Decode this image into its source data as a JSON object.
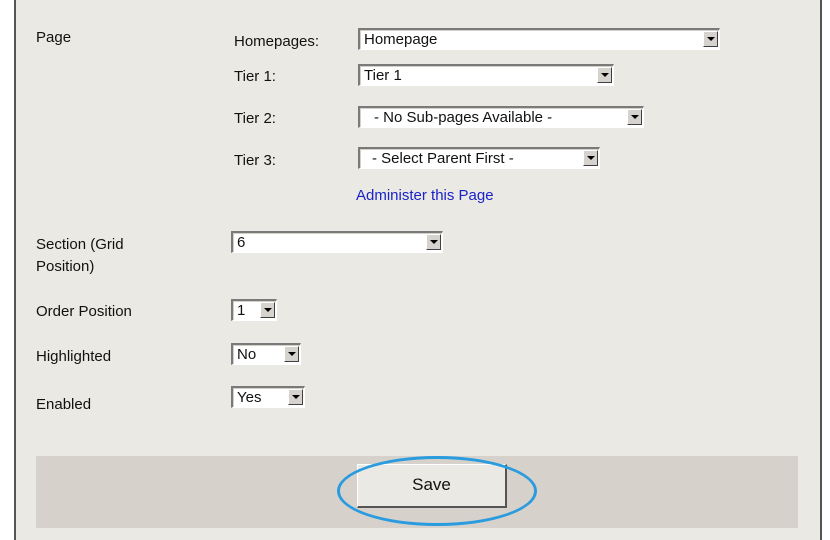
{
  "page_label": "Page",
  "homepages": {
    "label": "Homepages:",
    "value": "Homepage"
  },
  "tier1": {
    "label": "Tier 1:",
    "value": "Tier 1"
  },
  "tier2": {
    "label": "Tier 2:",
    "value": "- No Sub-pages Available -"
  },
  "tier3": {
    "label": "Tier 3:",
    "value": "- Select Parent First -"
  },
  "administer_link": "Administer this Page",
  "section": {
    "label_line1": "Section (Grid",
    "label_line2": "Position)",
    "value": "6"
  },
  "order_position": {
    "label": "Order Position",
    "value": "1"
  },
  "highlighted": {
    "label": "Highlighted",
    "value": "No"
  },
  "enabled": {
    "label": "Enabled",
    "value": "Yes"
  },
  "save_label": "Save",
  "colors": {
    "panel": "#ebe9e4",
    "footer": "#d6d2cb",
    "link": "#1a23c8",
    "highlight_oval": "#2b9be0"
  }
}
